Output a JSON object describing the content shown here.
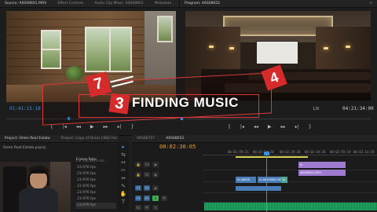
{
  "source_tabs": [
    "Source: A6S08601.MOV",
    "Effect Controls",
    "Audio Clip Mixer: A6S08601",
    "Metadata"
  ],
  "program_tabs": [
    "Program: A6S08652",
    "≡"
  ],
  "source_monitor": {
    "timecode": "01:41:15:18",
    "controls": [
      "{",
      "|◂",
      "◂◂",
      "▶",
      "▸▸",
      "▸|",
      "}"
    ]
  },
  "program_monitor": {
    "timecode": "04:21:34:00",
    "fit": "1/8",
    "controls": [
      "{",
      "|◂",
      "◂◂",
      "▶",
      "▸▸",
      "▸|",
      "}"
    ]
  },
  "overlay": {
    "title": "FINDING MUSIC",
    "tiles": [
      "7",
      "3",
      "4"
    ]
  },
  "project": {
    "tabs": [
      "Project: Orem Real Estate",
      "Project: Copy of Orem 1482 Hor"
    ],
    "project_file": "Orem Real Estate.prproj",
    "item_count": "1 of 136 items sel...",
    "column_header": "Frame Rate",
    "frame_rates": [
      "23.976 fps",
      "23.976 fps",
      "23.976 fps",
      "23.976 fps",
      "23.976 fps",
      "23.976 fps",
      "23.976 fps"
    ]
  },
  "sequence": {
    "tabs": [
      "A6S08707",
      "A6S08652"
    ],
    "timecode": "00:02:30:05",
    "ruler": [
      "00:01:59:21",
      "00:02:14:20",
      "00:02:29:20",
      "00:02:44:20",
      "00:02:59:19",
      "00:03:14:19"
    ],
    "tracks": [
      "V3",
      "V2",
      "V1",
      "A1",
      "A2"
    ],
    "clips": {
      "v3": "fx",
      "v2a": "A6S08652.MOV",
      "v1a": "fx A6S08",
      "v1b": "fx A6S08652.MOV",
      "v1c": "fx"
    }
  },
  "tools": [
    "▸",
    "⇆",
    "↔",
    "✂",
    "⇔",
    "✎",
    "✋",
    "T"
  ],
  "colors": {
    "accent_blue": "#3b8fe0",
    "timecode_orange": "#e0a13a",
    "title_red": "#d62b2b"
  }
}
